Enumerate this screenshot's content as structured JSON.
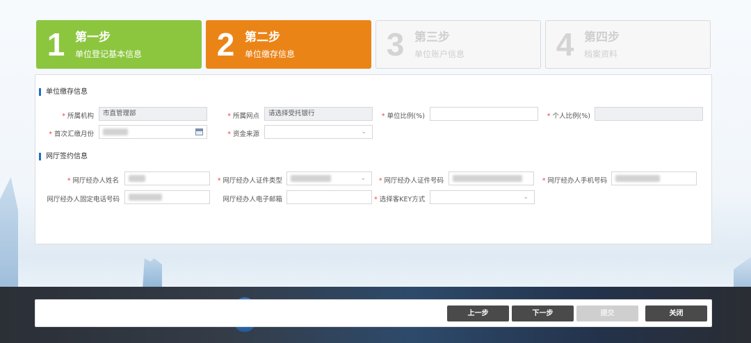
{
  "steps": [
    {
      "num": "1",
      "title": "第一步",
      "subtitle": "单位登记基本信息",
      "state": "done"
    },
    {
      "num": "2",
      "title": "第二步",
      "subtitle": "单位缴存信息",
      "state": "active"
    },
    {
      "num": "3",
      "title": "第三步",
      "subtitle": "单位账户信息",
      "state": "todo"
    },
    {
      "num": "4",
      "title": "第四步",
      "subtitle": "档案资料",
      "state": "todo"
    }
  ],
  "section1": {
    "title": "单位缴存信息",
    "org_label": "所属机构",
    "org_value": "市直管理部",
    "branch_label": "所属网点",
    "branch_placeholder": "请选择受托银行",
    "unit_ratio_label": "单位比例(%)",
    "unit_ratio_value": "",
    "personal_ratio_label": "个人比例(%)",
    "personal_ratio_value": "",
    "first_month_label": "首次汇缴月份",
    "fund_source_label": "资金来源",
    "fund_source_value": ""
  },
  "section2": {
    "title": "网厅签约信息",
    "agent_name_label": "网厅经办人姓名",
    "id_type_label": "网厅经办人证件类型",
    "id_no_label": "网厅经办人证件号码",
    "mobile_label": "网厅经办人手机号码",
    "phone_label": "网厅经办人固定电话号码",
    "email_label": "网厅经办人电子邮箱",
    "email_value": "",
    "key_label": "选择客KEY方式",
    "key_value": ""
  },
  "footer": {
    "prev": "上一步",
    "next": "下一步",
    "submit": "提交",
    "close": "关闭"
  }
}
